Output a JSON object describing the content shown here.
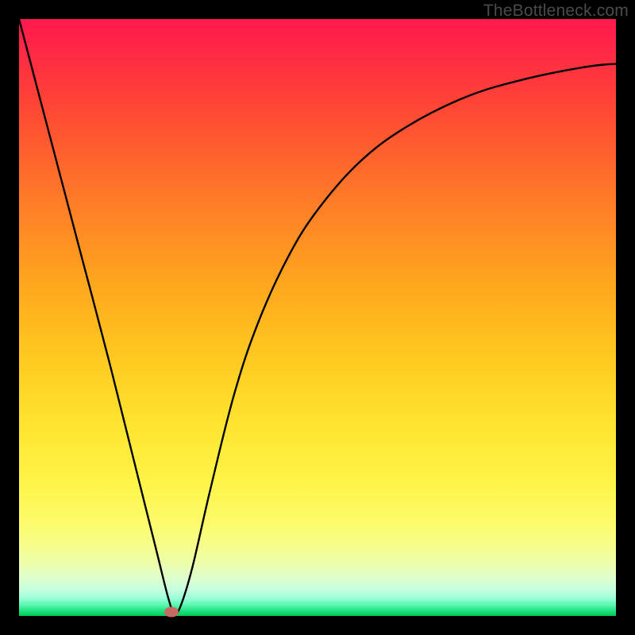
{
  "watermark": "TheBottleneck.com",
  "chart_data": {
    "type": "line",
    "title": "",
    "xlabel": "",
    "ylabel": "",
    "xlim": [
      0,
      1
    ],
    "ylim": [
      0,
      1
    ],
    "grid": false,
    "legend": false,
    "series": [
      {
        "name": "curve",
        "x": [
          0.0,
          0.05,
          0.1,
          0.15,
          0.2,
          0.23,
          0.25,
          0.26,
          0.27,
          0.29,
          0.32,
          0.36,
          0.4,
          0.45,
          0.5,
          0.57,
          0.65,
          0.75,
          0.85,
          0.95,
          1.0
        ],
        "values": [
          1.0,
          0.81,
          0.62,
          0.43,
          0.23,
          0.11,
          0.03,
          0.005,
          0.015,
          0.08,
          0.21,
          0.37,
          0.49,
          0.6,
          0.68,
          0.76,
          0.82,
          0.87,
          0.9,
          0.92,
          0.925
        ]
      }
    ],
    "marker": {
      "x": 0.255,
      "y": 0.006
    },
    "colors": {
      "curve": "#000000",
      "marker": "#c66a63",
      "gradient_top": "#ff1a4d",
      "gradient_bottom": "#00c853"
    }
  }
}
